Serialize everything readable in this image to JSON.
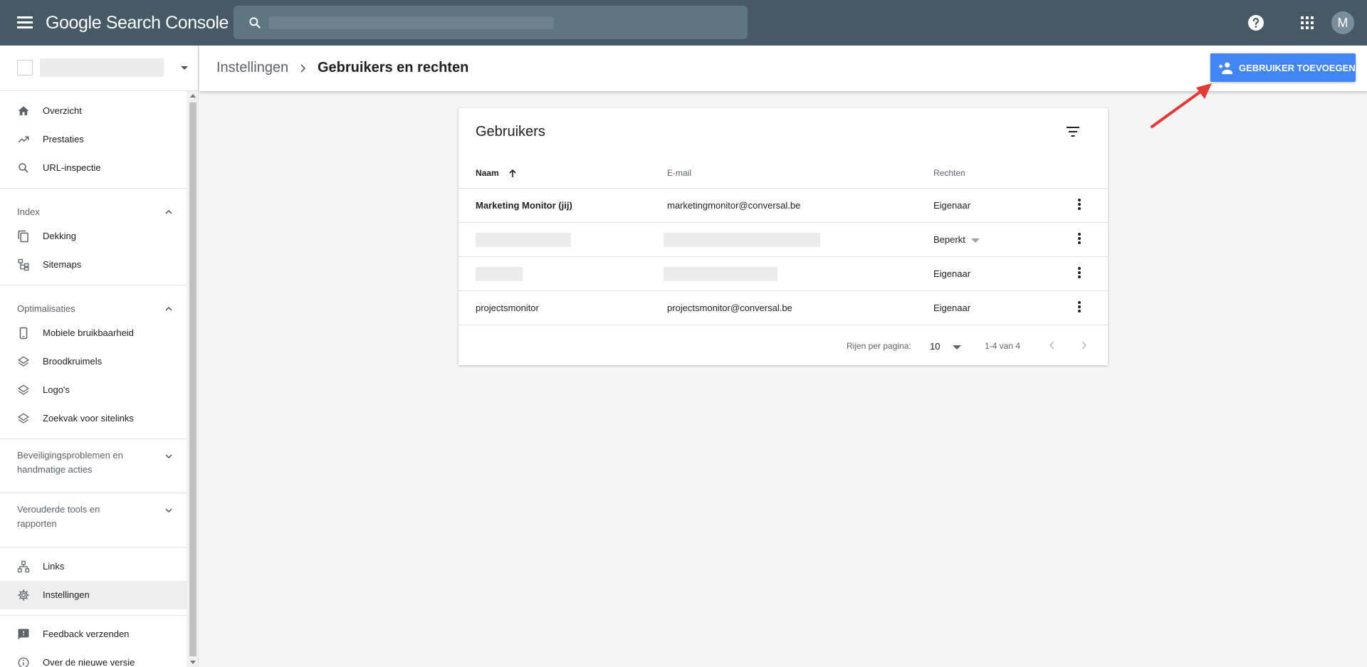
{
  "app": {
    "brand": "Google Search Console",
    "avatar_letter": "M",
    "search": {
      "value": "",
      "placeholder": ""
    }
  },
  "sidebar": {
    "items": [
      {
        "label": "Overzicht",
        "icon": "home-icon"
      },
      {
        "label": "Prestaties",
        "icon": "trending-up-icon"
      },
      {
        "label": "URL-inspectie",
        "icon": "search-icon"
      },
      {
        "label": "Dekking",
        "icon": "file-copy-icon"
      },
      {
        "label": "Sitemaps",
        "icon": "sitemap-icon"
      },
      {
        "label": "Mobiele bruikbaarheid",
        "icon": "phone-icon"
      },
      {
        "label": "Broodkruimels",
        "icon": "layers-icon"
      },
      {
        "label": "Logo's",
        "icon": "layers-icon"
      },
      {
        "label": "Zoekvak voor sitelinks",
        "icon": "layers-icon"
      },
      {
        "label": "Links",
        "icon": "links-icon"
      },
      {
        "label": "Instellingen",
        "icon": "gear-icon"
      },
      {
        "label": "Feedback verzenden",
        "icon": "feedback-icon"
      },
      {
        "label": "Over de nieuwe versie",
        "icon": "info-icon"
      }
    ],
    "sections": {
      "index": "Index",
      "optimalisaties": "Optimalisaties",
      "beveiliging": "Beveiligingsproblemen en handmatige acties",
      "verouderd": "Verouderde tools en rapporten"
    }
  },
  "header": {
    "crumb_parent": "Instellingen",
    "crumb_current": "Gebruikers en rechten",
    "add_user_label": "GEBRUIKER TOEVOEGEN"
  },
  "card": {
    "title": "Gebruikers",
    "columns": {
      "name": "Naam",
      "email": "E-mail",
      "rights": "Rechten"
    },
    "rows": [
      {
        "name": "Marketing Monitor (jij)",
        "email": "marketingmonitor@conversal.be",
        "rights": "Eigenaar"
      },
      {
        "name": "",
        "email": "",
        "rights": "Beperkt"
      },
      {
        "name": "",
        "email": "",
        "rights": "Eigenaar"
      },
      {
        "name": "projectsmonitor",
        "email": "projectsmonitor@conversal.be",
        "rights": "Eigenaar"
      }
    ],
    "footer": {
      "rows_per_page_label": "Rijen per pagina:",
      "rows_per_page_value": "10",
      "range": "1-4 van 4"
    }
  },
  "colors": {
    "topbar": "#455a64",
    "accent": "#4285f4",
    "annotation_arrow": "#e53935"
  }
}
